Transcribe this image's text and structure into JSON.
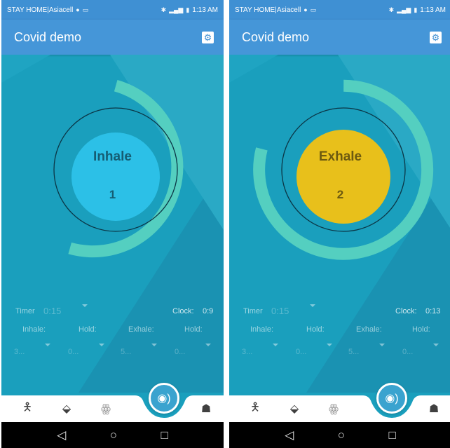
{
  "colors": {
    "appbar": "#4596d8",
    "statusbar": "#3f90d3",
    "background": "#1a9fbd",
    "ring": "#54cfc0",
    "inhale": "#2cc0e7",
    "exhale": "#e8c01b"
  },
  "phones": [
    {
      "status": {
        "carrier": "STAY HOME|Asiacell",
        "time": "1:13 AM"
      },
      "appbar": {
        "title": "Covid demo",
        "settings_icon": "gear-icon"
      },
      "breath": {
        "label": "Inhale",
        "count": "1",
        "phase": "inhale",
        "progress": 0.45
      },
      "controls": {
        "timer_label": "Timer",
        "timer_value": "0:15",
        "clock_label": "Clock:",
        "clock_value": "0:9",
        "headers": [
          "Inhale:",
          "Hold:",
          "Exhale:",
          "Hold:"
        ],
        "values": [
          "3...",
          "0...",
          "5...",
          "0..."
        ]
      },
      "nav": [
        "person-icon",
        "drop-icon",
        "lungs-icon",
        "speaker-icon",
        "cough-icon"
      ]
    },
    {
      "status": {
        "carrier": "STAY HOME|Asiacell",
        "time": "1:13 AM"
      },
      "appbar": {
        "title": "Covid demo",
        "settings_icon": "gear-icon"
      },
      "breath": {
        "label": "Exhale",
        "count": "2",
        "phase": "exhale",
        "progress": 0.58
      },
      "controls": {
        "timer_label": "Timer",
        "timer_value": "0:15",
        "clock_label": "Clock:",
        "clock_value": "0:13",
        "headers": [
          "Inhale:",
          "Hold:",
          "Exhale:",
          "Hold:"
        ],
        "values": [
          "3...",
          "0...",
          "5...",
          "0..."
        ]
      },
      "nav": [
        "person-icon",
        "drop-icon",
        "lungs-icon",
        "speaker-icon",
        "cough-icon"
      ]
    }
  ]
}
